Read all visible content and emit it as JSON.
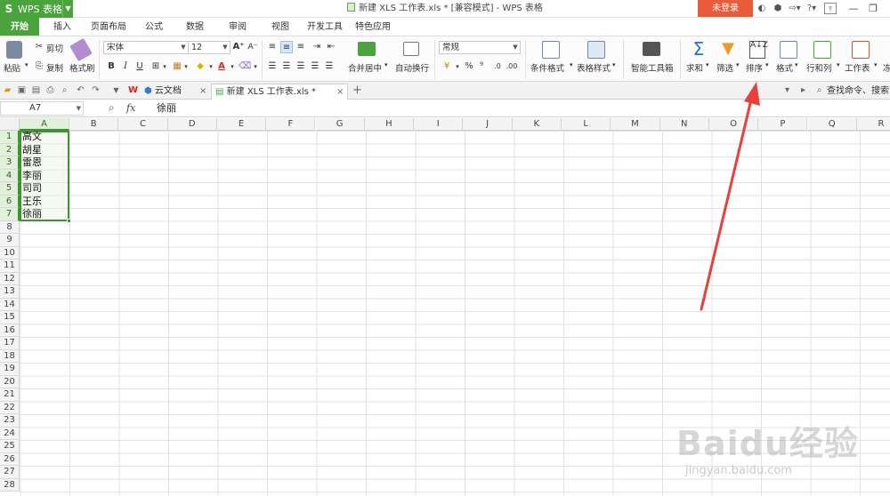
{
  "app": {
    "name": "WPS 表格",
    "window_title": "新建 XLS 工作表.xls * [兼容模式] - WPS 表格",
    "login_label": "未登录"
  },
  "menu_tabs": [
    "开始",
    "插入",
    "页面布局",
    "公式",
    "数据",
    "审阅",
    "视图",
    "开发工具",
    "特色应用"
  ],
  "ribbon": {
    "paste": "粘贴",
    "cut": "剪切",
    "copy": "复制",
    "format_painter": "格式刷",
    "font_name": "宋体",
    "font_size": "12",
    "merge_center": "合并居中",
    "wrap_text": "自动换行",
    "number_format": "常规",
    "conditional_format": "条件格式",
    "table_style": "表格样式",
    "smart_toolbox": "智能工具箱",
    "sum": "求和",
    "filter": "筛选",
    "sort": "排序",
    "format": "格式",
    "rows_cols": "行和列",
    "worksheet": "工作表",
    "freeze": "冻"
  },
  "doc_tabs": {
    "cloud": "云文档",
    "active": "新建 XLS 工作表.xls *",
    "search": "查找命令、搜索模"
  },
  "formula_bar": {
    "name_box": "A7",
    "fx": "fx",
    "value": "徐丽"
  },
  "columns": [
    "A",
    "B",
    "C",
    "D",
    "E",
    "F",
    "G",
    "H",
    "I",
    "J",
    "K",
    "L",
    "M",
    "N",
    "O",
    "P",
    "Q",
    "R"
  ],
  "rows": [
    "1",
    "2",
    "3",
    "4",
    "5",
    "6",
    "7",
    "8",
    "9",
    "10",
    "11",
    "12",
    "13",
    "14",
    "15",
    "16",
    "17",
    "18",
    "19",
    "20",
    "21",
    "22",
    "23",
    "24",
    "25",
    "26",
    "27",
    "28"
  ],
  "cells_a": [
    "高文",
    "胡星",
    "雷恩",
    "李丽",
    "司司",
    "王乐",
    "徐丽"
  ],
  "watermark": {
    "brand": "Baidu经验",
    "url": "jingyan.baidu.com"
  },
  "colors": {
    "accent": "#4aa33d",
    "login": "#e85b3b",
    "arrow": "#e8403a"
  }
}
